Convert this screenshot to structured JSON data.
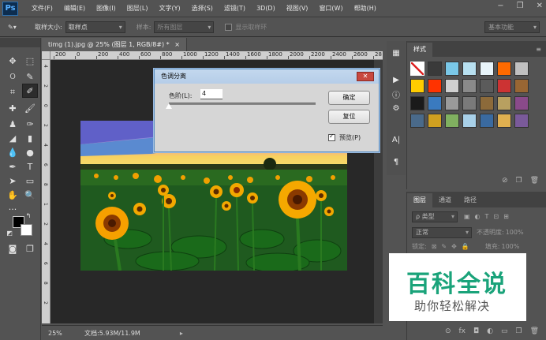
{
  "app": {
    "logo": "Ps",
    "menu": [
      "文件(F)",
      "编辑(E)",
      "图像(I)",
      "图层(L)",
      "文字(Y)",
      "选择(S)",
      "滤镜(T)",
      "3D(D)",
      "视图(V)",
      "窗口(W)",
      "帮助(H)"
    ],
    "window_controls": [
      "−",
      "❐",
      "✕"
    ]
  },
  "options": {
    "sample_size_label": "取样大小:",
    "sample_size_value": "取样点",
    "sample_label": "样本:",
    "sample_value": "所有图层",
    "show_ring_label": "显示取样环",
    "workspace": "基本功能"
  },
  "document": {
    "tab_title": "timg (1).jpg @ 25% (图层 1, RGB/8#) *",
    "tab_close": "×",
    "zoom": "25%",
    "doc_info": "文档:5.93M/11.9M",
    "ruler_h": [
      "200",
      "0",
      "200",
      "400",
      "600",
      "800",
      "1000",
      "1200",
      "1400",
      "1600",
      "1800",
      "2000",
      "2200",
      "2400",
      "2600",
      "28"
    ],
    "ruler_v": [
      "4",
      "2",
      "0",
      "2",
      "4",
      "6",
      "8",
      "1",
      "2",
      "4",
      "6",
      "8",
      "2"
    ]
  },
  "dialog": {
    "title": "色调分离",
    "close": "✕",
    "levels_label": "色阶(L):",
    "levels_value": "4",
    "levels_slider_fraction": 0.0,
    "ok": "确定",
    "reset": "复位",
    "preview_label": "预览(P)",
    "preview_checked": true
  },
  "icon_strip": [
    "▦",
    "▶",
    "ⓘ",
    "⚙",
    "A|",
    "¶"
  ],
  "styles_panel": {
    "tab": "样式",
    "menu": "≡",
    "swatches": [
      "#ffffff",
      "#3a3a3a",
      "#7ac8e8",
      "#b8e0f0",
      "#e8f4fa",
      "#ff6a00",
      "#c0c0c0",
      "#ffcc00",
      "#ff3300",
      "#d0d0d0",
      "#8a8a8a",
      "#5b5b5b",
      "#cc3333",
      "#996633",
      "#1a1a1a",
      "#3a7abf",
      "#9a9a9a",
      "#7a7a7a",
      "#8c6a3a",
      "#b8a060",
      "#8a4a8a",
      "#4a6a8a",
      "#d0a020",
      "#80b060",
      "#a8d0e8",
      "#3a6aa0",
      "#e0b050",
      "#7a5a9a"
    ],
    "footer_icons": [
      "⊘",
      "❐",
      "🗑"
    ]
  },
  "layers_panel": {
    "tabs": [
      "图层",
      "通道",
      "路径"
    ],
    "filter": "ρ 类型",
    "blend_mode": "正常",
    "opacity_label": "不透明度:",
    "opacity_value": "100%",
    "lock_label": "锁定:",
    "fill_label": "填充:",
    "fill_value": "100%",
    "footer_icons": [
      "⊙",
      "fx",
      "◘",
      "◐",
      "▭",
      "❐",
      "🗑"
    ]
  },
  "watermark": {
    "main": "百科全说",
    "sub": "助你轻松解决"
  }
}
